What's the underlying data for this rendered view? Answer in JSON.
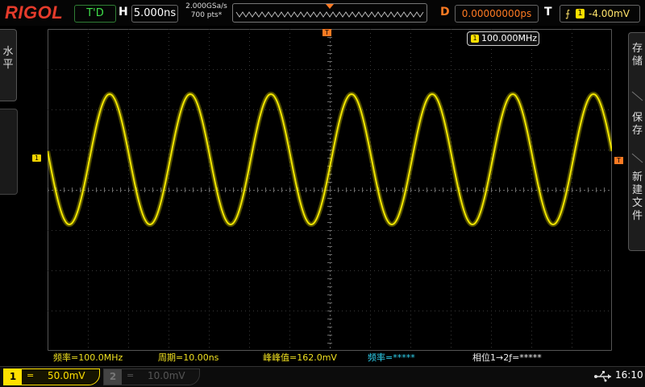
{
  "brand": "RIGOL",
  "status": {
    "mode": "T'D",
    "h_label": "H",
    "timebase": "5.000ns",
    "sample_rate": "2.000GSa/s",
    "memory_depth": "700 pts*",
    "d_label": "D",
    "delay": "0.00000000ps",
    "t_label": "T",
    "trigger_edge": "rising-edge-icon",
    "trigger_source": "1",
    "trigger_level": "-4.00mV"
  },
  "left_menu": {
    "label": "水\n平"
  },
  "right_menu": {
    "items": [
      {
        "label": "存\n储"
      },
      {
        "label": "保\n存"
      },
      {
        "label": "新\n建\n文\n件"
      }
    ]
  },
  "markers": {
    "channel1": "1",
    "trigger_pos": "T",
    "trigger_level": "T"
  },
  "freq_counter": {
    "channel": "1",
    "value": "100.000MHz"
  },
  "measurements": {
    "freq": "频率=100.0MHz",
    "period": "周期=10.00ns",
    "vpp": "峰峰值=162.0mV",
    "freq2": "频率=*****",
    "phase": "相位1→2ƒ=*****"
  },
  "channels": [
    {
      "num": "1",
      "coupling": "=",
      "scale": "50.0mV",
      "active": true
    },
    {
      "num": "2",
      "coupling": "=",
      "scale": "10.0mV",
      "active": false
    }
  ],
  "clock": "16:10",
  "waveform": {
    "frequency_mhz": 100.0,
    "vpp_mv": 162.0,
    "color": "#f2e600"
  },
  "colors": {
    "ch1": "#ffe000",
    "trigger": "#ff7a22",
    "accent": "#e53b2b"
  }
}
